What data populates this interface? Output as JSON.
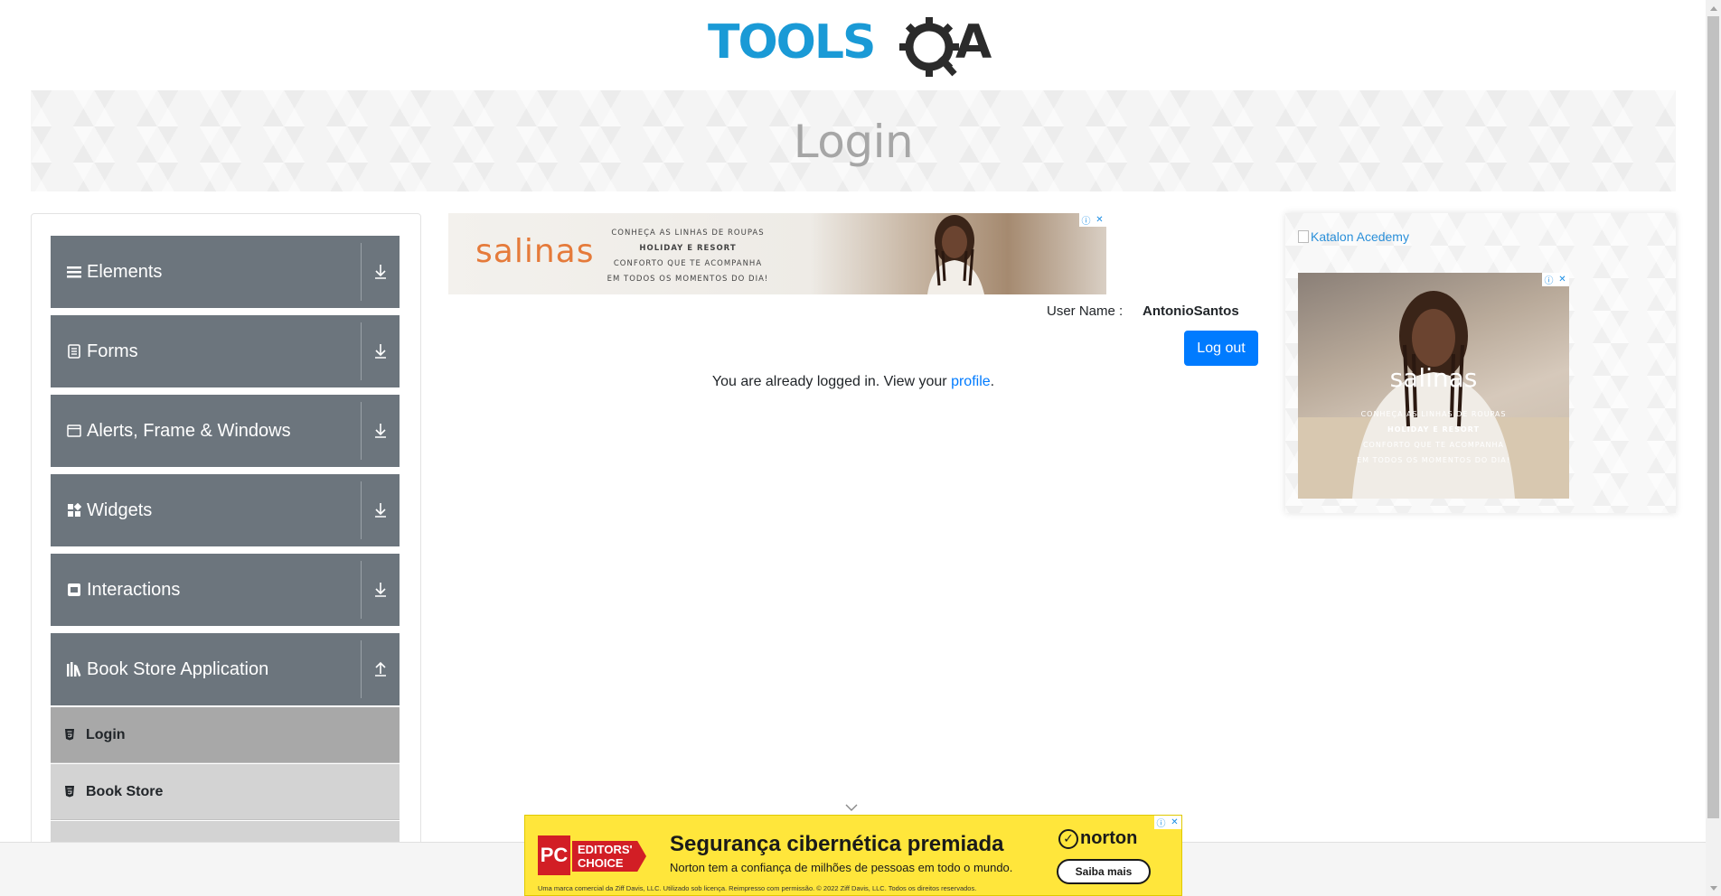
{
  "logo": {
    "text": "TOOLSQA",
    "brand_color": "#1a9ad6",
    "dark_color": "#2b2b2b"
  },
  "page": {
    "title": "Login"
  },
  "sidebar": {
    "groups": [
      {
        "label": "Elements",
        "icon": "list-icon"
      },
      {
        "label": "Forms",
        "icon": "form-icon"
      },
      {
        "label": "Alerts, Frame & Windows",
        "icon": "window-icon"
      },
      {
        "label": "Widgets",
        "icon": "widgets-icon"
      },
      {
        "label": "Interactions",
        "icon": "interactions-icon"
      },
      {
        "label": "Book Store Application",
        "icon": "books-icon",
        "expanded": true
      }
    ],
    "items": [
      {
        "label": "Login",
        "active": true
      },
      {
        "label": "Book Store",
        "active": false
      }
    ]
  },
  "top_ad": {
    "brand": "salinas",
    "lines": [
      "CONHEÇA AS LINHAS DE ROUPAS",
      "HOLIDAY E RESORT",
      "CONFORTO QUE TE ACOMPANHA",
      "EM TODOS OS MOMENTOS DO DIA!"
    ]
  },
  "user": {
    "label": "User Name :",
    "value": "AntonioSantos",
    "logout_label": "Log out"
  },
  "status": {
    "prefix": "You are already logged in. View your ",
    "link": "profile",
    "suffix": "."
  },
  "side_ad": {
    "broken_image_alt": "Katalon Acedemy",
    "brand": "salinas",
    "lines": [
      "CONHEÇA AS LINHAS DE ROUPAS",
      "HOLIDAY E RESORT",
      "CONFORTO QUE TE ACOMPANHA",
      "EM TODOS OS MOMENTOS DO DIA!"
    ]
  },
  "bottom_ad": {
    "pc": "PC",
    "badge": "EDITORS' CHOICE",
    "headline": "Segurança cibernética premiada",
    "subline": "Norton tem a confiança de milhões de pessoas em todo o mundo.",
    "fine_print": "Uma marca comercial da Ziff Davis, LLC. Utilizado sob licença. Reimpresso com permissão. © 2022 Ziff Davis, LLC. Todos os direitos reservados.",
    "norton": "norton",
    "cta": "Saiba mais"
  },
  "colors": {
    "sidebar_header": "#6c757d",
    "active_item": "#a8a8a8",
    "item_bg": "#d3d3d3",
    "primary": "#007bff",
    "ad_yellow": "#ffe63b"
  }
}
